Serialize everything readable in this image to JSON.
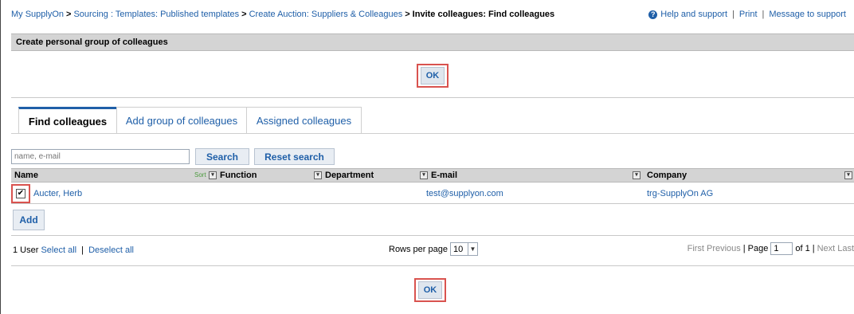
{
  "breadcrumb": {
    "items": [
      "My SupplyOn",
      "Sourcing : Templates: Published templates",
      "Create Auction: Suppliers & Colleagues"
    ],
    "separator": ">",
    "current": "Invite colleagues: Find colleagues"
  },
  "help_links": {
    "help": "Help and support",
    "print": "Print",
    "message": "Message to support",
    "pipe": "|"
  },
  "section_title": "Create personal group of colleagues",
  "ok_label": "OK",
  "tabs": [
    {
      "label": "Find colleagues",
      "active": true
    },
    {
      "label": "Add group of colleagues",
      "active": false
    },
    {
      "label": "Assigned colleagues",
      "active": false
    }
  ],
  "search": {
    "placeholder": "name, e-mail",
    "search_label": "Search",
    "reset_label": "Reset search"
  },
  "table": {
    "columns": {
      "name": "Name",
      "sort": "Sort",
      "function": "Function",
      "department": "Department",
      "email": "E-mail",
      "company": "Company"
    },
    "rows": [
      {
        "checked": true,
        "name": "Aucter, Herb",
        "function": "",
        "department": "",
        "email": "test@supplyon.com",
        "company": "trg-SupplyOn AG"
      }
    ]
  },
  "add_label": "Add",
  "pager": {
    "count": "1 User",
    "select_all": "Select all",
    "separator": "|",
    "deselect_all": "Deselect all",
    "rows_label": "Rows per page",
    "rows_value": "10",
    "first": "First",
    "previous": "Previous",
    "page_label": "Page",
    "page_value": "1",
    "of_label": "of 1",
    "next": "Next",
    "last": "Last"
  },
  "colors": {
    "link": "#1f5fa8",
    "highlight": "#d9534f",
    "header_bg": "#d4d4d4",
    "button_bg": "#e8edf3"
  },
  "icons": {
    "help": "question-circle-icon",
    "filter": "filter-dropdown-icon",
    "select_arrow": "chevron-down-icon",
    "checkbox": "checkmark-icon"
  }
}
